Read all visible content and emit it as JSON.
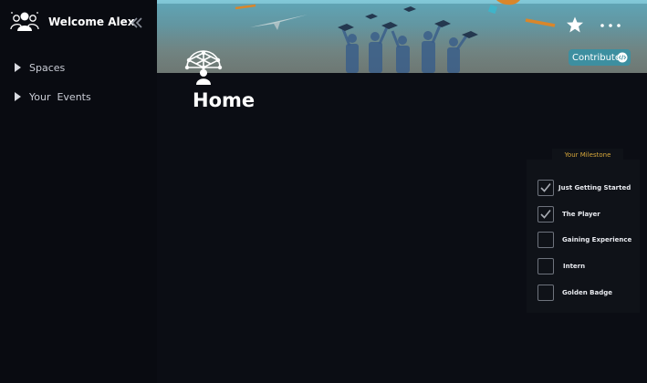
{
  "sidebar": {
    "title": "Welcome Alex",
    "items": [
      {
        "label": "Spaces"
      },
      {
        "label": "Your  Events"
      }
    ]
  },
  "header": {
    "contribute_label": "Contribute"
  },
  "main": {
    "title": "Home"
  },
  "milestones": {
    "heading": "Your Milestone",
    "items": [
      {
        "label": "Just Getting Started",
        "checked": true
      },
      {
        "label": "The Player",
        "checked": true
      },
      {
        "label": "Gaining Experience",
        "checked": false
      },
      {
        "label": "Intern",
        "checked": false
      },
      {
        "label": "Golden Badge",
        "checked": false
      }
    ]
  },
  "colors": {
    "sidebar_bg": "#090b11",
    "main_bg": "#0b0d14",
    "accent": "#3d8fa0",
    "milestone_heading": "#d6a63a"
  }
}
